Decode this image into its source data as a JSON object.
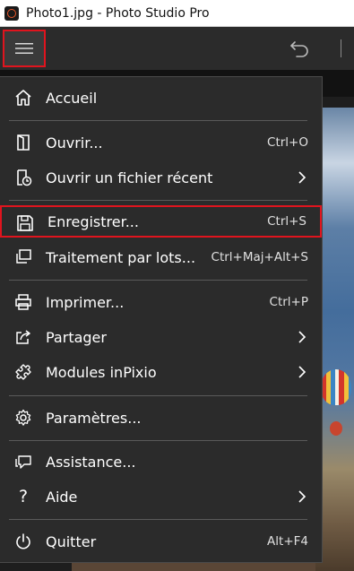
{
  "window": {
    "title": "Photo1.jpg - Photo Studio Pro"
  },
  "menu": {
    "home": {
      "label": "Accueil"
    },
    "open": {
      "label": "Ouvrir...",
      "shortcut": "Ctrl+O"
    },
    "open_recent": {
      "label": "Ouvrir un fichier récent"
    },
    "save": {
      "label": "Enregistrer...",
      "shortcut": "Ctrl+S"
    },
    "batch": {
      "label": "Traitement par lots...",
      "shortcut": "Ctrl+Maj+Alt+S"
    },
    "print": {
      "label": "Imprimer...",
      "shortcut": "Ctrl+P"
    },
    "share": {
      "label": "Partager"
    },
    "modules": {
      "label": "Modules inPixio"
    },
    "settings": {
      "label": "Paramètres..."
    },
    "assistance": {
      "label": "Assistance..."
    },
    "help": {
      "label": "Aide"
    },
    "quit": {
      "label": "Quitter",
      "shortcut": "Alt+F4"
    }
  },
  "colors": {
    "highlight": "#e0141e",
    "menu_bg": "#2b2b2b",
    "toolbar_bg": "#2b2b2b"
  },
  "icons": {
    "app": "app-logo-icon",
    "menu": "hamburger-icon",
    "undo": "undo-icon",
    "home": "home-icon",
    "open": "open-file-icon",
    "recent": "recent-file-icon",
    "save": "save-icon",
    "batch": "batch-icon",
    "print": "printer-icon",
    "share": "share-icon",
    "modules": "puzzle-icon",
    "settings": "gear-icon",
    "assistance": "chat-icon",
    "help": "question-icon",
    "quit": "power-icon"
  }
}
